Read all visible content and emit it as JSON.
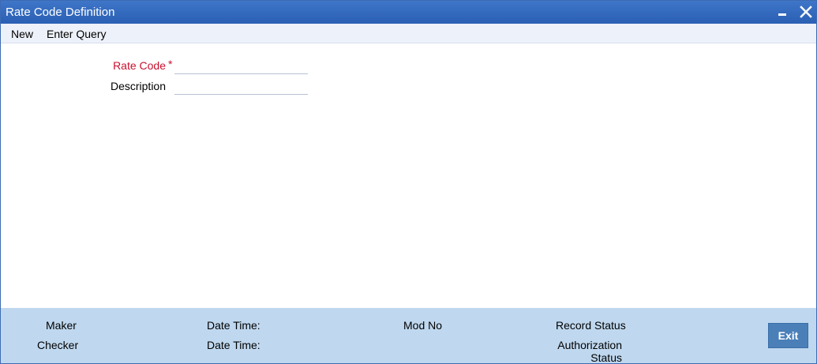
{
  "window": {
    "title": "Rate Code Definition",
    "minimize_icon": "minimize-icon",
    "close_icon": "close-icon"
  },
  "menu": {
    "new_label": "New",
    "enter_query_label": "Enter Query"
  },
  "form": {
    "rate_code_label": "Rate Code",
    "required_marker": "*",
    "rate_code_value": "",
    "description_label": "Description",
    "description_value": ""
  },
  "footer": {
    "maker_label": "Maker",
    "checker_label": "Checker",
    "date_time_label_1": "Date Time:",
    "date_time_label_2": "Date Time:",
    "mod_no_label": "Mod No",
    "record_status_label": "Record Status",
    "authorization_status_label_line1": "Authorization",
    "authorization_status_label_line2": "Status",
    "exit_label": "Exit"
  },
  "colors": {
    "titlebar": "#2f66ba",
    "menubar": "#edf1f9",
    "footer": "#bfd8ef",
    "required": "#c8102e",
    "exit_button": "#4a7fb8"
  }
}
